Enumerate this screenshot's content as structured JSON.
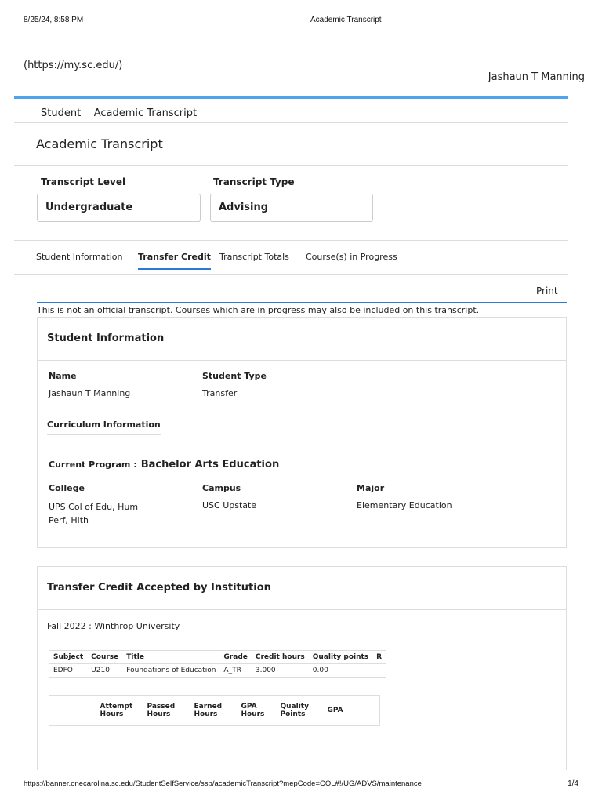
{
  "print_header": {
    "datetime": "8/25/24, 8:58 PM",
    "title": "Academic Transcript"
  },
  "site_link": "(https://my.sc.edu/)",
  "user_name": "Jashaun T Manning",
  "breadcrumb": [
    "Student",
    "Academic Transcript"
  ],
  "page_title": "Academic Transcript",
  "filters": {
    "level_label": "Transcript Level",
    "level_value": "Undergraduate",
    "type_label": "Transcript Type",
    "type_value": "Advising"
  },
  "tabs": [
    {
      "label": "Student Information"
    },
    {
      "label": "Transfer Credit",
      "active": true
    },
    {
      "label": "Transcript Totals"
    },
    {
      "label": "Course(s) in Progress"
    }
  ],
  "print_label": "Print",
  "notice": "This is not an official transcript. Courses which are in progress may also be included on this transcript.",
  "student_info": {
    "heading": "Student Information",
    "name_label": "Name",
    "name": "Jashaun T Manning",
    "type_label": "Student Type",
    "type": "Transfer",
    "curriculum_label": "Curriculum Information",
    "program_label": "Current Program :",
    "program": "Bachelor Arts Education",
    "college_label": "College",
    "college": "UPS Col of Edu, Hum Perf, Hlth",
    "campus_label": "Campus",
    "campus": "USC Upstate",
    "major_label": "Major",
    "major": "Elementary Education"
  },
  "transfer": {
    "heading": "Transfer Credit Accepted by Institution",
    "term": "Fall 2022 : Winthrop University",
    "columns": [
      "Subject",
      "Course",
      "Title",
      "Grade",
      "Credit hours",
      "Quality points",
      "R"
    ],
    "rows": [
      [
        "EDFO",
        "U210",
        "Foundations of Education",
        "A_TR",
        "3.000",
        "0.00",
        ""
      ]
    ],
    "totals_columns": [
      "",
      "Attempt Hours",
      "Passed Hours",
      "Earned Hours",
      "GPA Hours",
      "Quality Points",
      "GPA"
    ]
  },
  "footer": {
    "url": "https://banner.onecarolina.sc.edu/StudentSelfService/ssb/academicTranscript?mepCode=COL#!/UG/ADVS/maintenance",
    "page": "1/4"
  }
}
